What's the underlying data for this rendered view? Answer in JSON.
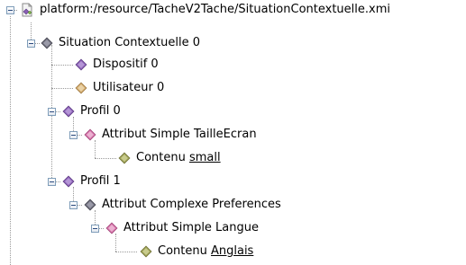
{
  "tree": {
    "root": {
      "label": "platform:/resource/TacheV2Tache/SituationContextuelle.xmi"
    },
    "situation": {
      "label": "Situation Contextuelle 0"
    },
    "dispositif": {
      "label": "Dispositif 0"
    },
    "utilisateur": {
      "label": "Utilisateur 0"
    },
    "profil0": {
      "label": "Profil 0"
    },
    "attr_taille": {
      "label": "Attribut Simple TailleEcran"
    },
    "contenu_small": {
      "prefix": "Contenu",
      "value": "small"
    },
    "profil1": {
      "label": "Profil 1"
    },
    "attr_preferences": {
      "label": "Attribut Complexe Preferences"
    },
    "attr_langue": {
      "label": "Attribut Simple Langue"
    },
    "contenu_anglais": {
      "prefix": "Contenu",
      "value": "Anglais"
    }
  },
  "icons": {
    "root": "xmi-resource-icon",
    "situation": "situation-diamond-icon",
    "dispositif": "diamond-purple-icon",
    "utilisateur": "diamond-tan-icon",
    "profil": "diamond-purple-icon",
    "attribut_simple": "diamond-pink-icon",
    "attribut_complexe": "diamond-gray-icon",
    "contenu": "diamond-olive-icon"
  },
  "colors": {
    "connector": "#9a9a9a",
    "toggle_border": "#7f9db9",
    "purple": "#8a5fb4",
    "pink": "#d36fa6",
    "tan": "#d0a86a",
    "gray": "#6c6c7a",
    "olive": "#9c9f55"
  }
}
